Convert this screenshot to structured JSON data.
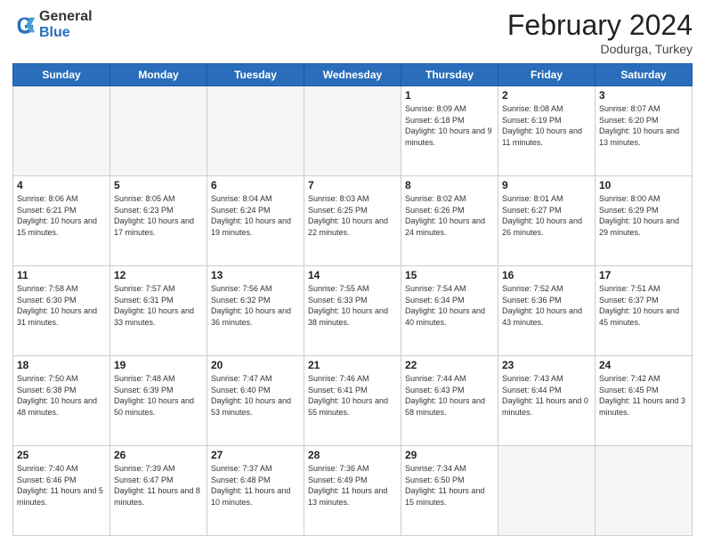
{
  "header": {
    "logo_general": "General",
    "logo_blue": "Blue",
    "title": "February 2024",
    "location": "Dodurga, Turkey"
  },
  "days_of_week": [
    "Sunday",
    "Monday",
    "Tuesday",
    "Wednesday",
    "Thursday",
    "Friday",
    "Saturday"
  ],
  "weeks": [
    [
      {
        "day": "",
        "info": ""
      },
      {
        "day": "",
        "info": ""
      },
      {
        "day": "",
        "info": ""
      },
      {
        "day": "",
        "info": ""
      },
      {
        "day": "1",
        "info": "Sunrise: 8:09 AM\nSunset: 6:18 PM\nDaylight: 10 hours and 9 minutes."
      },
      {
        "day": "2",
        "info": "Sunrise: 8:08 AM\nSunset: 6:19 PM\nDaylight: 10 hours and 11 minutes."
      },
      {
        "day": "3",
        "info": "Sunrise: 8:07 AM\nSunset: 6:20 PM\nDaylight: 10 hours and 13 minutes."
      }
    ],
    [
      {
        "day": "4",
        "info": "Sunrise: 8:06 AM\nSunset: 6:21 PM\nDaylight: 10 hours and 15 minutes."
      },
      {
        "day": "5",
        "info": "Sunrise: 8:05 AM\nSunset: 6:23 PM\nDaylight: 10 hours and 17 minutes."
      },
      {
        "day": "6",
        "info": "Sunrise: 8:04 AM\nSunset: 6:24 PM\nDaylight: 10 hours and 19 minutes."
      },
      {
        "day": "7",
        "info": "Sunrise: 8:03 AM\nSunset: 6:25 PM\nDaylight: 10 hours and 22 minutes."
      },
      {
        "day": "8",
        "info": "Sunrise: 8:02 AM\nSunset: 6:26 PM\nDaylight: 10 hours and 24 minutes."
      },
      {
        "day": "9",
        "info": "Sunrise: 8:01 AM\nSunset: 6:27 PM\nDaylight: 10 hours and 26 minutes."
      },
      {
        "day": "10",
        "info": "Sunrise: 8:00 AM\nSunset: 6:29 PM\nDaylight: 10 hours and 29 minutes."
      }
    ],
    [
      {
        "day": "11",
        "info": "Sunrise: 7:58 AM\nSunset: 6:30 PM\nDaylight: 10 hours and 31 minutes."
      },
      {
        "day": "12",
        "info": "Sunrise: 7:57 AM\nSunset: 6:31 PM\nDaylight: 10 hours and 33 minutes."
      },
      {
        "day": "13",
        "info": "Sunrise: 7:56 AM\nSunset: 6:32 PM\nDaylight: 10 hours and 36 minutes."
      },
      {
        "day": "14",
        "info": "Sunrise: 7:55 AM\nSunset: 6:33 PM\nDaylight: 10 hours and 38 minutes."
      },
      {
        "day": "15",
        "info": "Sunrise: 7:54 AM\nSunset: 6:34 PM\nDaylight: 10 hours and 40 minutes."
      },
      {
        "day": "16",
        "info": "Sunrise: 7:52 AM\nSunset: 6:36 PM\nDaylight: 10 hours and 43 minutes."
      },
      {
        "day": "17",
        "info": "Sunrise: 7:51 AM\nSunset: 6:37 PM\nDaylight: 10 hours and 45 minutes."
      }
    ],
    [
      {
        "day": "18",
        "info": "Sunrise: 7:50 AM\nSunset: 6:38 PM\nDaylight: 10 hours and 48 minutes."
      },
      {
        "day": "19",
        "info": "Sunrise: 7:48 AM\nSunset: 6:39 PM\nDaylight: 10 hours and 50 minutes."
      },
      {
        "day": "20",
        "info": "Sunrise: 7:47 AM\nSunset: 6:40 PM\nDaylight: 10 hours and 53 minutes."
      },
      {
        "day": "21",
        "info": "Sunrise: 7:46 AM\nSunset: 6:41 PM\nDaylight: 10 hours and 55 minutes."
      },
      {
        "day": "22",
        "info": "Sunrise: 7:44 AM\nSunset: 6:43 PM\nDaylight: 10 hours and 58 minutes."
      },
      {
        "day": "23",
        "info": "Sunrise: 7:43 AM\nSunset: 6:44 PM\nDaylight: 11 hours and 0 minutes."
      },
      {
        "day": "24",
        "info": "Sunrise: 7:42 AM\nSunset: 6:45 PM\nDaylight: 11 hours and 3 minutes."
      }
    ],
    [
      {
        "day": "25",
        "info": "Sunrise: 7:40 AM\nSunset: 6:46 PM\nDaylight: 11 hours and 5 minutes."
      },
      {
        "day": "26",
        "info": "Sunrise: 7:39 AM\nSunset: 6:47 PM\nDaylight: 11 hours and 8 minutes."
      },
      {
        "day": "27",
        "info": "Sunrise: 7:37 AM\nSunset: 6:48 PM\nDaylight: 11 hours and 10 minutes."
      },
      {
        "day": "28",
        "info": "Sunrise: 7:36 AM\nSunset: 6:49 PM\nDaylight: 11 hours and 13 minutes."
      },
      {
        "day": "29",
        "info": "Sunrise: 7:34 AM\nSunset: 6:50 PM\nDaylight: 11 hours and 15 minutes."
      },
      {
        "day": "",
        "info": ""
      },
      {
        "day": "",
        "info": ""
      }
    ]
  ]
}
